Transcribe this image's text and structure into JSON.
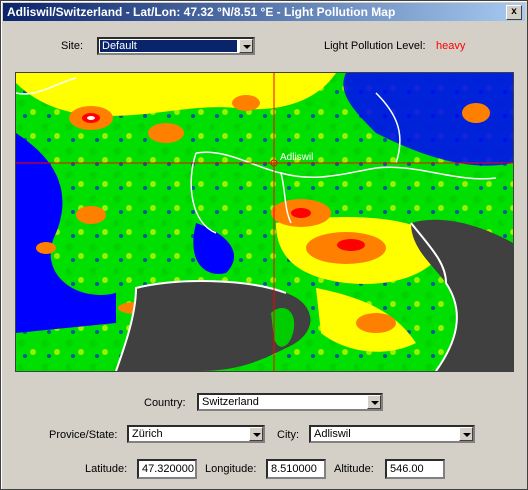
{
  "window": {
    "title": "Adliswil/Switzerland - Lat/Lon: 47.32 °N/8.51 °E - Light Pollution Map",
    "close_glyph": "x"
  },
  "site": {
    "label": "Site:",
    "value": "Default"
  },
  "pollution": {
    "label": "Light Pollution Level:",
    "value": "heavy",
    "color": "#ff0000"
  },
  "map": {
    "marker_label": "Adliswil",
    "crosshair_color": "#ff0000"
  },
  "country": {
    "label": "Country:",
    "value": "Switzerland"
  },
  "state": {
    "label": "Provice/State:",
    "value": "Zürich"
  },
  "city": {
    "label": "City:",
    "value": "Adliswil"
  },
  "coords": {
    "latitude_label": "Latitude:",
    "latitude": "47.320000",
    "longitude_label": "Longitude:",
    "longitude": "8.510000",
    "altitude_label": "Altitude:",
    "altitude": "546.00"
  }
}
